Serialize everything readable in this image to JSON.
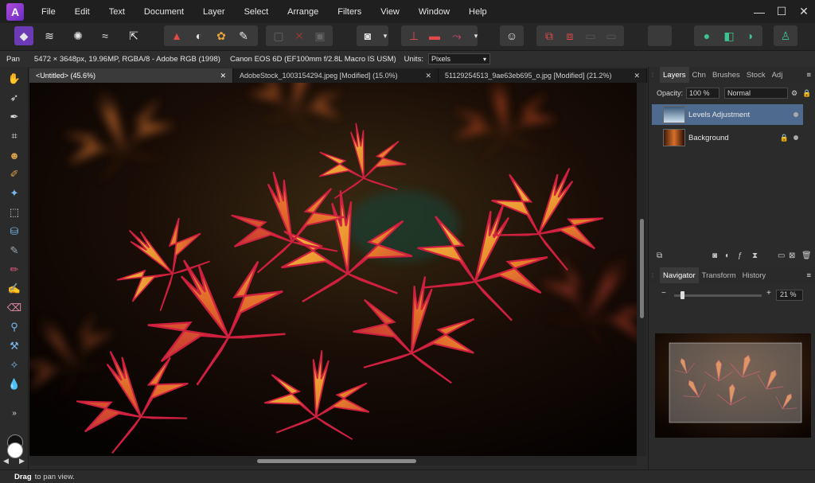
{
  "app": {
    "logo_letter": "A"
  },
  "menu": [
    "File",
    "Edit",
    "Text",
    "Document",
    "Layer",
    "Select",
    "Arrange",
    "Filters",
    "View",
    "Window",
    "Help"
  ],
  "window_controls": {
    "minimize": "—",
    "maximize": "☐",
    "close": "✕"
  },
  "context_bar": {
    "tool": "Pan",
    "doc_info": "5472 × 3648px, 19.96MP, RGBA/8 - Adobe RGB (1998)",
    "camera": "Canon EOS 6D (EF100mm f/2.8L Macro IS USM)",
    "units_label": "Units:",
    "units_value": "Pixels"
  },
  "doc_tabs": [
    {
      "title": "<Untitled> (45.6%)",
      "close": "✕"
    },
    {
      "title": "AdobeStock_1003154294.jpeg [Modified] (15.0%)",
      "close": "✕"
    },
    {
      "title": "51129254513_9ae63eb695_o.jpg [Modified] (21.2%)",
      "close": "✕"
    }
  ],
  "layers_panel": {
    "tabs": [
      "Layers",
      "Chn",
      "Brushes",
      "Stock",
      "Adj"
    ],
    "opacity_label": "Opacity:",
    "opacity_value": "100 %",
    "blend_mode": "Normal",
    "layers": [
      {
        "name": "Levels Adjustment",
        "selected": true
      },
      {
        "name": "Background",
        "selected": false
      }
    ]
  },
  "navigator_panel": {
    "tabs": [
      "Navigator",
      "Transform",
      "History"
    ],
    "zoom_value": "21 %",
    "zoom_minus": "−",
    "zoom_plus": "+"
  },
  "status": {
    "action": "Drag",
    "hint": "to pan view."
  },
  "colors": {
    "accent": "#4e6a8e",
    "menubar": "#1f1f1f",
    "panel": "#2b2b2b"
  }
}
